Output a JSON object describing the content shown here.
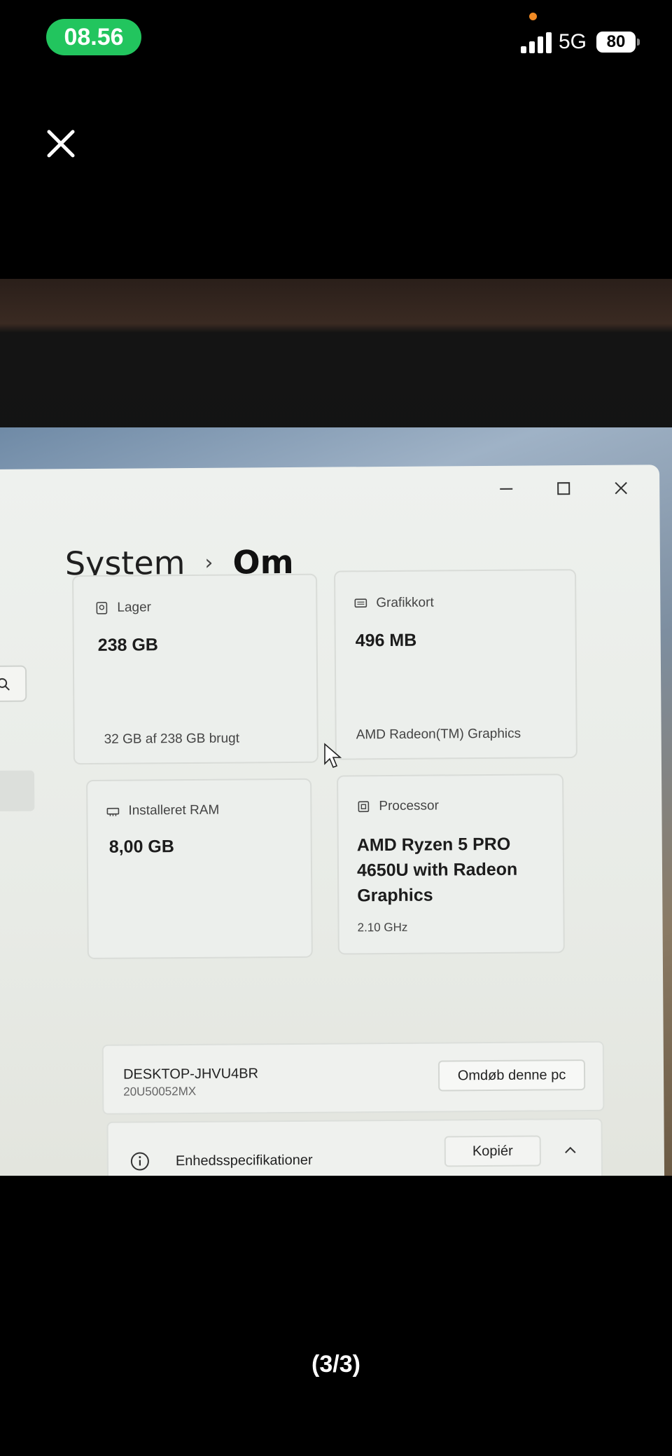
{
  "status_bar": {
    "time": "08.56",
    "network": "5G",
    "battery": "80",
    "colors": {
      "time_pill": "#22c55e",
      "recording_dot": "#f08a24"
    }
  },
  "viewer": {
    "close_icon": "close-icon",
    "page_indicator": "(3/3)"
  },
  "settings_window": {
    "breadcrumb": {
      "parent": "System",
      "separator": "›",
      "current": "Om"
    },
    "cards": {
      "storage": {
        "label": "Lager",
        "value": "238 GB",
        "detail": "32 GB af 238 GB brugt",
        "icon": "drive-icon"
      },
      "graphics": {
        "label": "Grafikkort",
        "value": "496 MB",
        "detail": "AMD Radeon(TM) Graphics",
        "icon": "gpu-icon"
      },
      "ram": {
        "label": "Installeret RAM",
        "value": "8,00 GB",
        "icon": "ram-icon"
      },
      "processor": {
        "label": "Processor",
        "value_line1": "AMD Ryzen 5 PRO",
        "value_line2": "4650U with Radeon",
        "value_line3": "Graphics",
        "detail": "2.10 GHz",
        "icon": "cpu-icon"
      }
    },
    "device": {
      "name": "DESKTOP-JHVU4BR",
      "model": "20U50052MX",
      "rename_label": "Omdøb denne pc"
    },
    "specifications": {
      "label": "Enhedsspecifikationer",
      "copy_label": "Kopiér"
    }
  }
}
